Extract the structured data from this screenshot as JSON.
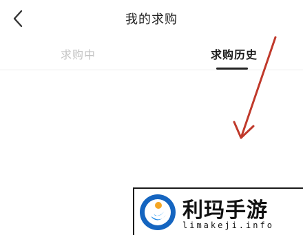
{
  "header": {
    "back_icon": "chevron-left-icon",
    "title": "我的求购"
  },
  "tabs": [
    {
      "label": "求购中",
      "active": false
    },
    {
      "label": "求购历史",
      "active": true
    }
  ],
  "overlay": {
    "annotation": "arrow-pointing-down",
    "arrow_color": "#c0392b"
  },
  "watermark": {
    "title": "利玛手游",
    "subtitle": "limakeji.info",
    "logo_colors": [
      "#1565c0",
      "#f5a623"
    ]
  },
  "colors": {
    "background": "#ffffff",
    "title_text": "#222222",
    "inactive_tab": "#c4c4c4",
    "active_tab": "#1a1a1a",
    "divider": "#ececec"
  }
}
